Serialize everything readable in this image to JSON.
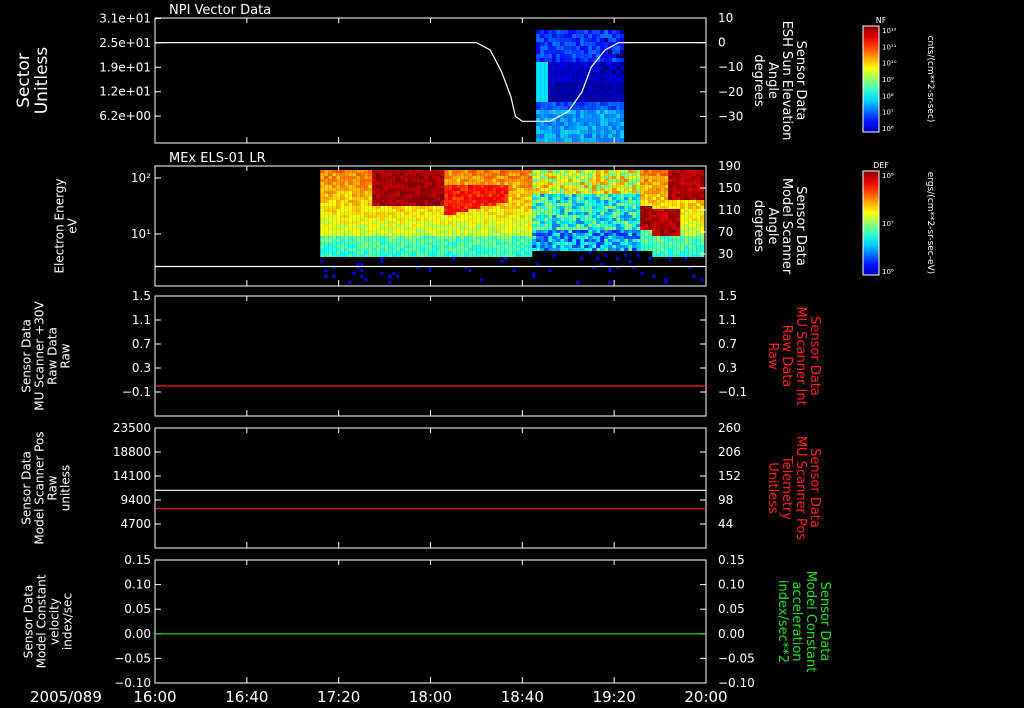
{
  "chart_data": [
    {
      "type": "heatmap",
      "title": "NPI Vector Data",
      "ylabel": [
        "Sector",
        "Unitless"
      ],
      "yticks": [
        "3.1e+01",
        "2.5e+01",
        "1.9e+01",
        "1.2e+01",
        "6.2e+00"
      ],
      "y2label": [
        "Sensor Data",
        "ESH Sun Elevation",
        "Angle",
        "degrees"
      ],
      "y2ticks": [
        "10",
        "0",
        "−10",
        "−20",
        "−30"
      ],
      "y2lim": [
        -40,
        10
      ],
      "series": [
        {
          "x": [
            "16:00",
            "18:20",
            "18:26",
            "18:31",
            "18:35",
            "18:37",
            "18:40",
            "18:44",
            "18:52",
            "19:00",
            "19:06",
            "19:10",
            "19:16",
            "19:22",
            "20:00"
          ],
          "values": [
            0,
            0,
            -3,
            -12,
            -22,
            -30,
            -32,
            -32,
            -32,
            -28,
            -20,
            -10,
            -3,
            0,
            0
          ],
          "color": "#ffffff"
        }
      ],
      "colorbar": {
        "label": "NF",
        "units": "cnts/(cm**2-sr-sec)",
        "ticks": [
          "10¹²",
          "10¹¹",
          "10¹⁰",
          "10⁹",
          "10⁸",
          "10⁷",
          "10⁶"
        ]
      }
    },
    {
      "type": "heatmap",
      "title": "MEx ELS-01 LR",
      "ylabel": [
        "Electron Energy",
        "eV"
      ],
      "yticks": [
        "10²",
        "10¹"
      ],
      "y2label": [
        "Sensor Data",
        "Model Scanner",
        "Angle",
        "degrees"
      ],
      "y2ticks": [
        "190",
        "150",
        "110",
        "70",
        "30"
      ],
      "y2lim": [
        0,
        190
      ],
      "series": [
        {
          "x": [
            "16:00",
            "20:00"
          ],
          "values": [
            80,
            80
          ],
          "color": "#ffffff"
        }
      ],
      "colorbar": {
        "label": "DEF",
        "units": "ergs/(cm**2-sr-sec-eV)",
        "ticks": [
          "10⁸",
          "10⁷",
          "10⁶"
        ]
      }
    },
    {
      "type": "line",
      "ylabel": [
        "Sensor Data",
        "MU Scanner +30V",
        "Raw Data",
        "Raw"
      ],
      "yticks": [
        "1.5",
        "1.1",
        "0.7",
        "0.3",
        "−0.1"
      ],
      "ylim": [
        -0.5,
        1.5
      ],
      "y2label": [
        "Sensor Data",
        "MU Scanner Int",
        "Raw Data",
        "Raw"
      ],
      "y2ticks": [
        "1.5",
        "1.1",
        "0.7",
        "0.3",
        "−0.1"
      ],
      "series": [
        {
          "x": [
            "16:00",
            "20:00"
          ],
          "values": [
            0.0,
            0.0
          ],
          "color": "#ff2020"
        }
      ]
    },
    {
      "type": "line",
      "ylabel": [
        "Sensor Data",
        "Model Scanner Pos",
        "Raw",
        "unitless"
      ],
      "yticks": [
        "23500",
        "18800",
        "14100",
        "9400",
        "4700"
      ],
      "ylim": [
        0,
        23500
      ],
      "y2label": [
        "Sensor Data",
        "MU Scanner Pos",
        "Telemetry",
        "Unitless"
      ],
      "y2ticks": [
        "260",
        "206",
        "152",
        "98",
        "44"
      ],
      "series": [
        {
          "x": [
            "16:00",
            "20:00"
          ],
          "values": [
            11300,
            11300
          ],
          "color": "#ffffff"
        },
        {
          "x": [
            "16:00",
            "20:00"
          ],
          "values": [
            7700,
            7700
          ],
          "color": "#ff2020"
        }
      ]
    },
    {
      "type": "line",
      "ylabel": [
        "Sensor Data",
        "Model Constant",
        "velocity",
        "index/sec"
      ],
      "yticks": [
        "0.15",
        "0.10",
        "0.05",
        "0.00",
        "−0.05",
        "−0.10"
      ],
      "ylim": [
        -0.1,
        0.15
      ],
      "y2label": [
        "Sensor Data",
        "Model Constant",
        "acceleration",
        "index/sec**2"
      ],
      "y2ticks": [
        "0.15",
        "0.10",
        "0.05",
        "0.00",
        "−0.05",
        "−0.10"
      ],
      "series": [
        {
          "x": [
            "16:00",
            "20:00"
          ],
          "values": [
            0.0,
            0.0
          ],
          "color": "#20e020"
        }
      ]
    }
  ],
  "xaxis": {
    "date": "2005/089",
    "ticks": [
      "16:00",
      "16:40",
      "17:20",
      "18:00",
      "18:40",
      "19:20",
      "20:00"
    ],
    "range": [
      "16:00",
      "20:00"
    ]
  }
}
